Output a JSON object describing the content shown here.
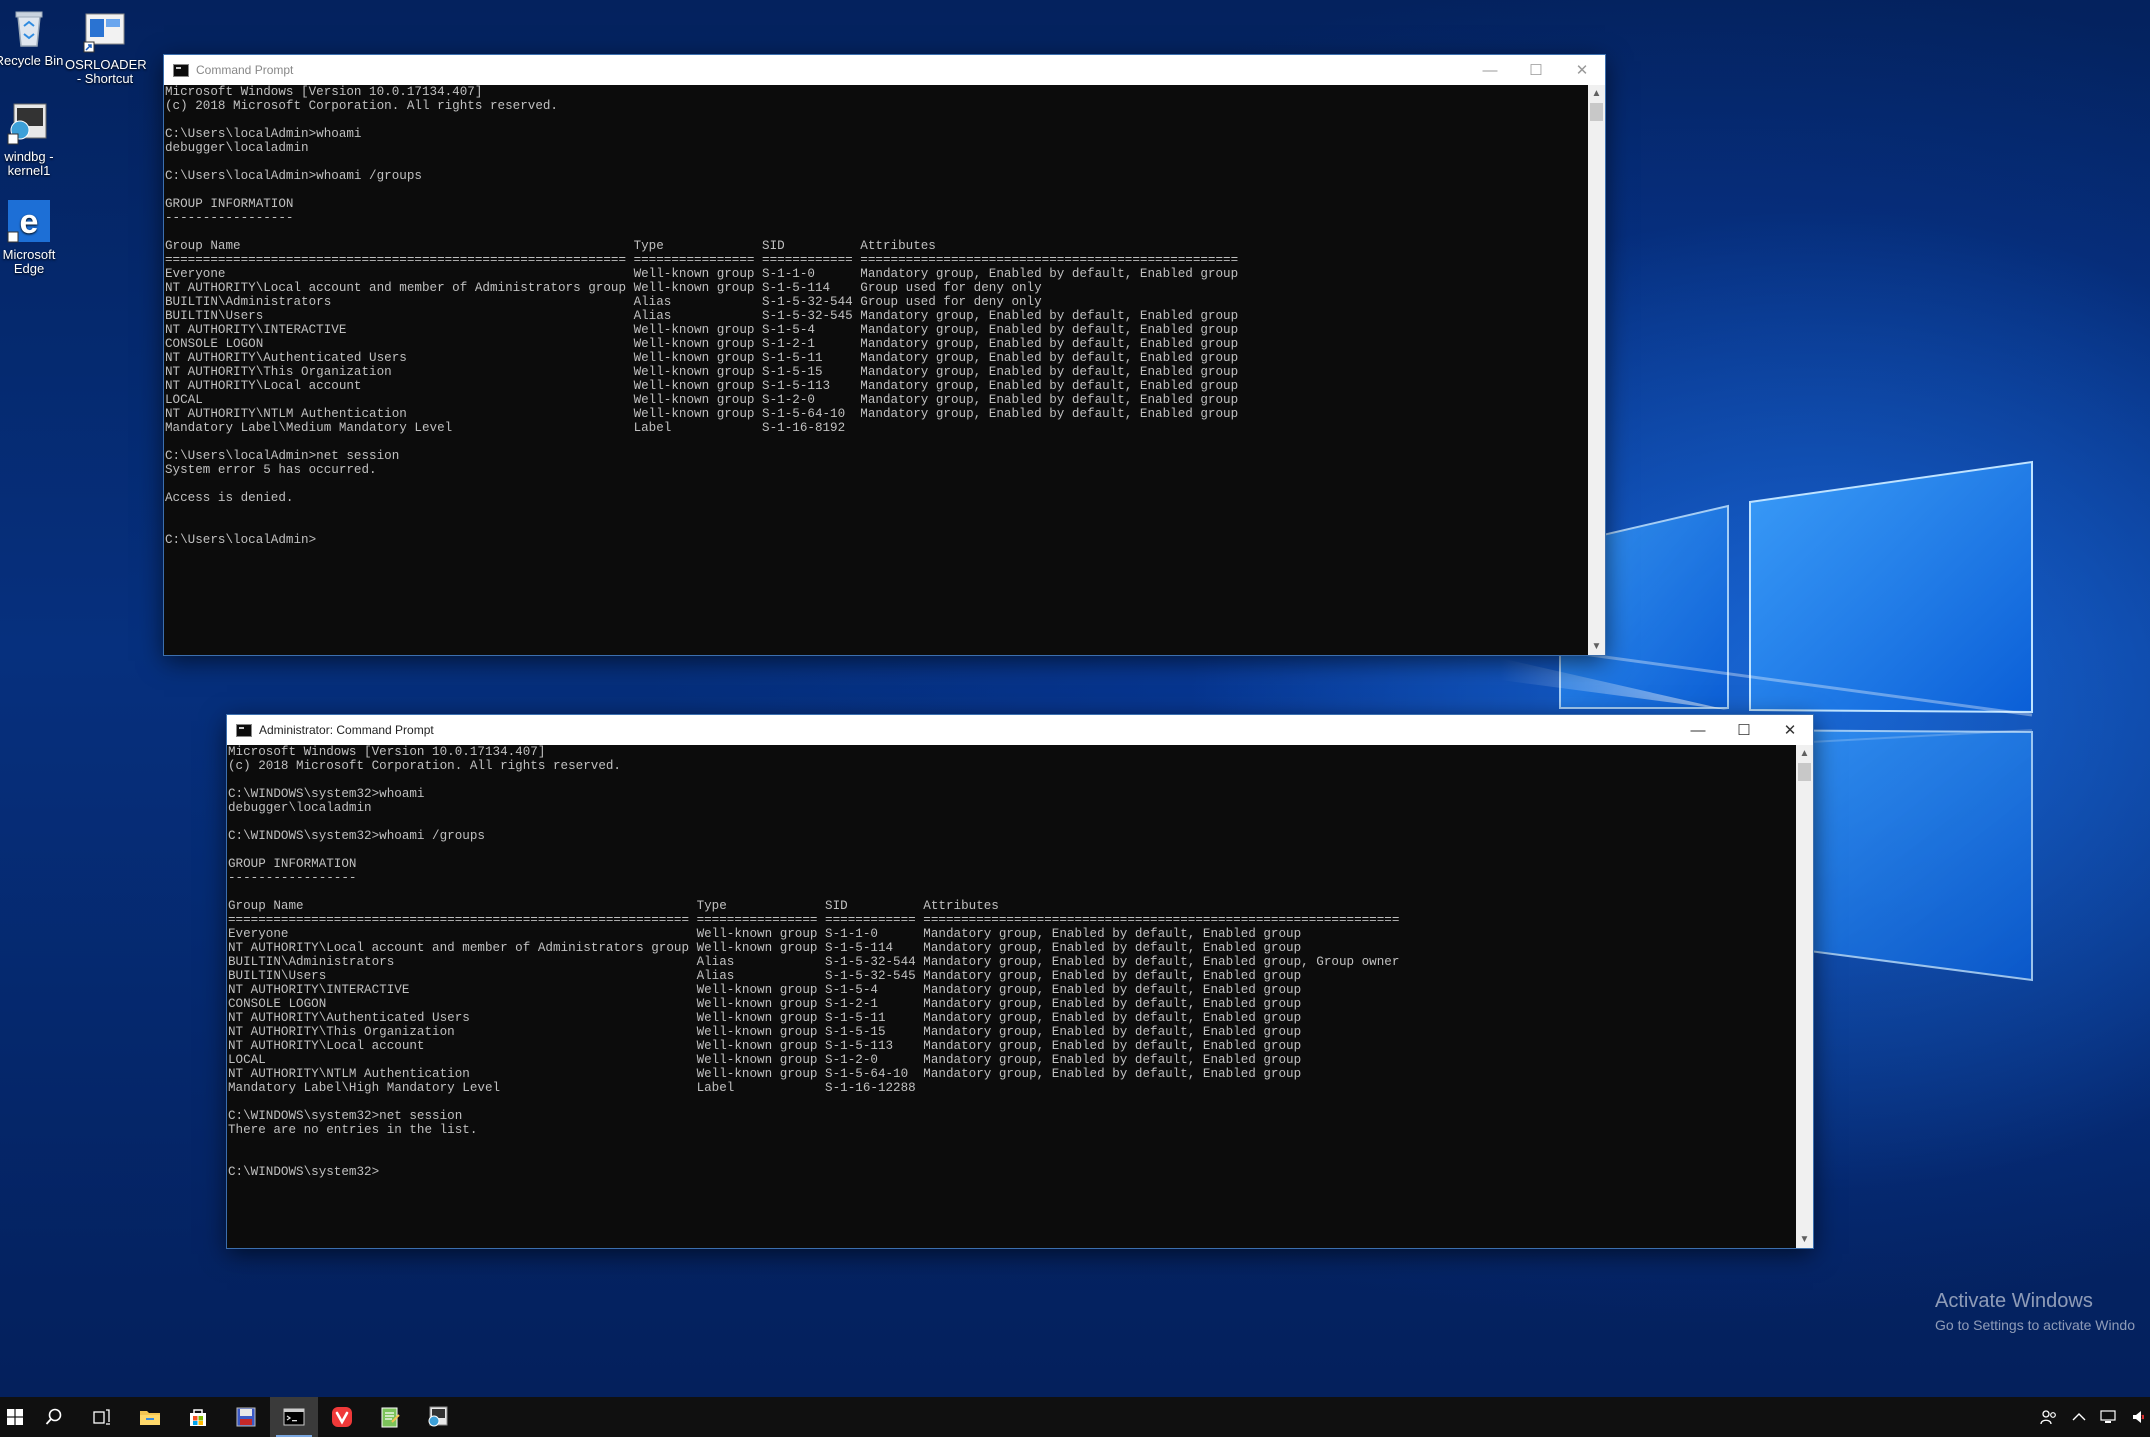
{
  "colors": {
    "console_bg": "#0c0c0c",
    "console_text": "#c0c0c0",
    "titlebar_bg": "#ffffff",
    "taskbar_bg": "#101010",
    "desktop_blue": "#06307e"
  },
  "desktop": {
    "icons": [
      {
        "label": "Recycle Bin",
        "icon": "recycle-bin-icon"
      },
      {
        "label": "OSRLOADER - Shortcut",
        "icon": "osrloader-shortcut-icon"
      },
      {
        "label": "windbg - kernel1",
        "icon": "windbg-icon"
      },
      {
        "label": "Microsoft Edge",
        "icon": "edge-icon"
      }
    ]
  },
  "cmd_window": {
    "title": "Command Prompt",
    "icon": "cmd-icon",
    "lines": [
      "Microsoft Windows [Version 10.0.17134.407]",
      "(c) 2018 Microsoft Corporation. All rights reserved.",
      "",
      "C:\\Users\\localAdmin>whoami",
      "debugger\\localadmin",
      "",
      "C:\\Users\\localAdmin>whoami /groups",
      "",
      "GROUP INFORMATION",
      "-----------------",
      "",
      "Group Name                                                    Type             SID          Attributes",
      "============================================================= ================ ============ ==================================================",
      "Everyone                                                      Well-known group S-1-1-0      Mandatory group, Enabled by default, Enabled group",
      "NT AUTHORITY\\Local account and member of Administrators group Well-known group S-1-5-114    Group used for deny only",
      "BUILTIN\\Administrators                                        Alias            S-1-5-32-544 Group used for deny only",
      "BUILTIN\\Users                                                 Alias            S-1-5-32-545 Mandatory group, Enabled by default, Enabled group",
      "NT AUTHORITY\\INTERACTIVE                                      Well-known group S-1-5-4      Mandatory group, Enabled by default, Enabled group",
      "CONSOLE LOGON                                                 Well-known group S-1-2-1      Mandatory group, Enabled by default, Enabled group",
      "NT AUTHORITY\\Authenticated Users                              Well-known group S-1-5-11     Mandatory group, Enabled by default, Enabled group",
      "NT AUTHORITY\\This Organization                                Well-known group S-1-5-15     Mandatory group, Enabled by default, Enabled group",
      "NT AUTHORITY\\Local account                                    Well-known group S-1-5-113    Mandatory group, Enabled by default, Enabled group",
      "LOCAL                                                         Well-known group S-1-2-0      Mandatory group, Enabled by default, Enabled group",
      "NT AUTHORITY\\NTLM Authentication                              Well-known group S-1-5-64-10  Mandatory group, Enabled by default, Enabled group",
      "Mandatory Label\\Medium Mandatory Level                        Label            S-1-16-8192",
      "",
      "C:\\Users\\localAdmin>net session",
      "System error 5 has occurred.",
      "",
      "Access is denied.",
      "",
      "",
      "C:\\Users\\localAdmin>"
    ]
  },
  "admin_window": {
    "title": "Administrator: Command Prompt",
    "icon": "cmd-icon",
    "lines": [
      "Microsoft Windows [Version 10.0.17134.407]",
      "(c) 2018 Microsoft Corporation. All rights reserved.",
      "",
      "C:\\WINDOWS\\system32>whoami",
      "debugger\\localadmin",
      "",
      "C:\\WINDOWS\\system32>whoami /groups",
      "",
      "GROUP INFORMATION",
      "-----------------",
      "",
      "Group Name                                                    Type             SID          Attributes",
      "============================================================= ================ ============ ===============================================================",
      "Everyone                                                      Well-known group S-1-1-0      Mandatory group, Enabled by default, Enabled group",
      "NT AUTHORITY\\Local account and member of Administrators group Well-known group S-1-5-114    Mandatory group, Enabled by default, Enabled group",
      "BUILTIN\\Administrators                                        Alias            S-1-5-32-544 Mandatory group, Enabled by default, Enabled group, Group owner",
      "BUILTIN\\Users                                                 Alias            S-1-5-32-545 Mandatory group, Enabled by default, Enabled group",
      "NT AUTHORITY\\INTERACTIVE                                      Well-known group S-1-5-4      Mandatory group, Enabled by default, Enabled group",
      "CONSOLE LOGON                                                 Well-known group S-1-2-1      Mandatory group, Enabled by default, Enabled group",
      "NT AUTHORITY\\Authenticated Users                              Well-known group S-1-5-11     Mandatory group, Enabled by default, Enabled group",
      "NT AUTHORITY\\This Organization                                Well-known group S-1-5-15     Mandatory group, Enabled by default, Enabled group",
      "NT AUTHORITY\\Local account                                    Well-known group S-1-5-113    Mandatory group, Enabled by default, Enabled group",
      "LOCAL                                                         Well-known group S-1-2-0      Mandatory group, Enabled by default, Enabled group",
      "NT AUTHORITY\\NTLM Authentication                              Well-known group S-1-5-64-10  Mandatory group, Enabled by default, Enabled group",
      "Mandatory Label\\High Mandatory Level                          Label            S-1-16-12288",
      "",
      "C:\\WINDOWS\\system32>net session",
      "There are no entries in the list.",
      "",
      "",
      "C:\\WINDOWS\\system32>"
    ]
  },
  "watermark": {
    "line1": "Activate Windows",
    "line2": "Go to Settings to activate Windo"
  },
  "taskbar": {
    "items": [
      {
        "icon": "start-icon"
      },
      {
        "icon": "search-icon"
      },
      {
        "icon": "task-view-icon"
      },
      {
        "icon": "file-explorer-icon"
      },
      {
        "icon": "store-icon"
      },
      {
        "icon": "save-disk-icon"
      },
      {
        "icon": "cmd-icon"
      },
      {
        "icon": "vivaldi-icon"
      },
      {
        "icon": "notepad-icon"
      },
      {
        "icon": "windbg-icon"
      }
    ]
  }
}
